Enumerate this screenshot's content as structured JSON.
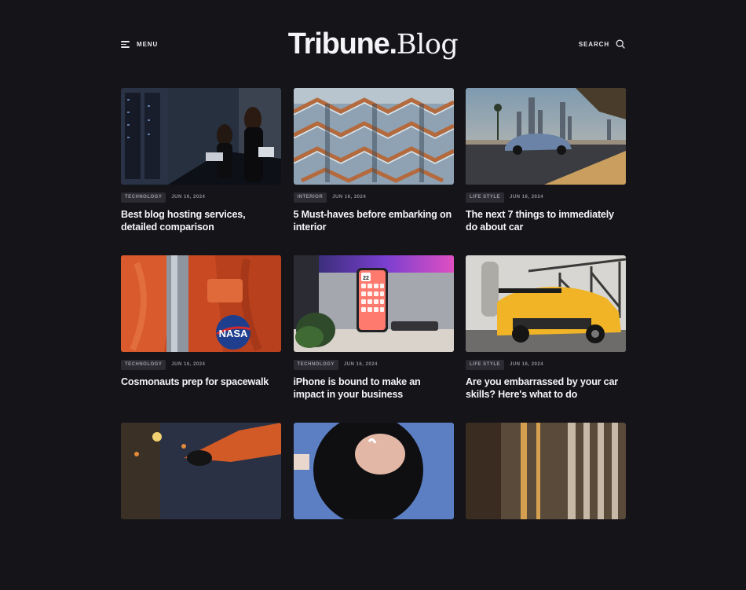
{
  "header": {
    "menu_label": "MENU",
    "logo_bold": "Tribune.",
    "logo_light": "Blog",
    "search_label": "SEARCH"
  },
  "posts": [
    {
      "category": "TECHNOLOGY",
      "date": "JUN 16, 2024",
      "title": "Best blog hosting services, detailed comparison"
    },
    {
      "category": "INTERIOR",
      "date": "JUN 16, 2024",
      "title": "5 Must-haves before embarking on interior"
    },
    {
      "category": "LIFE STYLE",
      "date": "JUN 16, 2024",
      "title": "The next 7 things to immediately do about car"
    },
    {
      "category": "TECHNOLOGY",
      "date": "JUN 16, 2024",
      "title": "Cosmonauts prep for spacewalk"
    },
    {
      "category": "TECHNOLOGY",
      "date": "JUN 16, 2024",
      "title": "iPhone is bound to make an impact in your business"
    },
    {
      "category": "LIFE STYLE",
      "date": "JUN 16, 2024",
      "title": "Are you embarrassed by your car skills? Here's what to do"
    }
  ],
  "images": {
    "nasa_patch_text": "NASA",
    "phone_clock": "22"
  },
  "colors": {
    "background": "#151419",
    "tag_background": "#2c2b32",
    "tag_text": "#9b9aa4"
  }
}
